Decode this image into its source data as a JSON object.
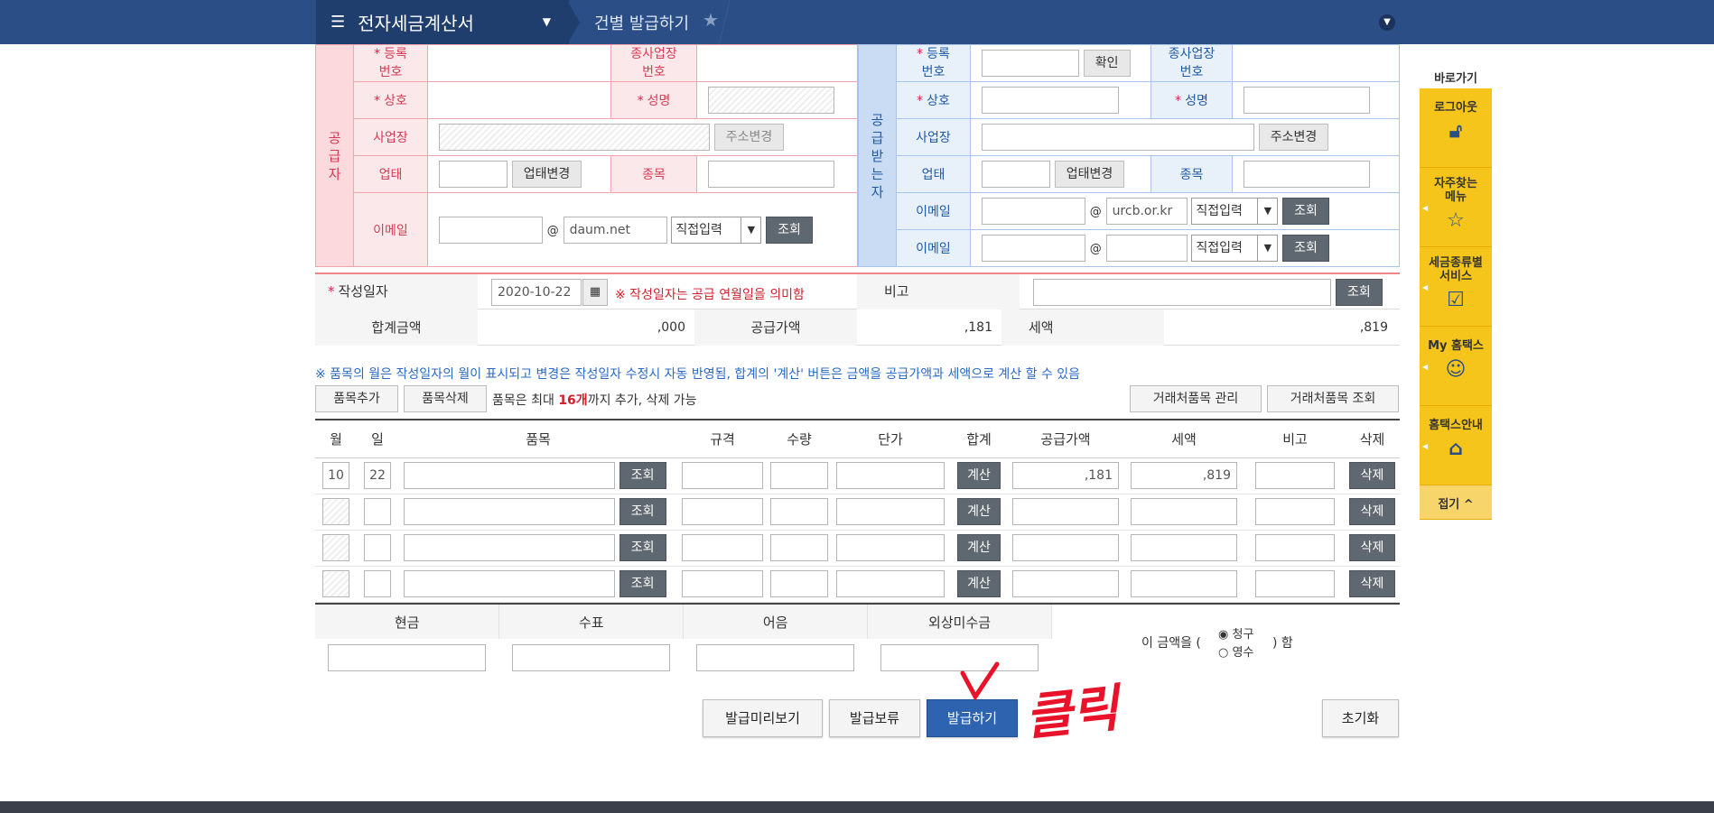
{
  "header": {
    "menu_title": "전자세금계산서",
    "breadcrumb": "건별 발급하기"
  },
  "supplier": {
    "side_label": "공급자",
    "reg_label": "등록\n번호",
    "sub_reg_label": "종사업장\n번호",
    "name_label": "상호",
    "ceo_label": "성명",
    "addr_label": "사업장",
    "addr_btn": "주소변경",
    "biz_label": "업태",
    "biz_btn": "업태변경",
    "item_label": "종목",
    "email_label": "이메일",
    "email_domain": "daum.net",
    "email_select": "직접입력",
    "lookup": "조회"
  },
  "receiver": {
    "side_label": "공급받는자",
    "reg_label": "등록\n번호",
    "confirm_btn": "확인",
    "sub_reg_label": "종사업장\n번호",
    "name_label": "상호",
    "ceo_label": "성명",
    "addr_label": "사업장",
    "addr_btn": "주소변경",
    "biz_label": "업태",
    "biz_btn": "업태변경",
    "item_label": "종목",
    "email_label": "이메일",
    "email_domain": "urcb.or.kr",
    "email_select": "직접입력",
    "lookup": "조회",
    "email2_label": "이메일",
    "email2_select": "직접입력",
    "lookup2": "조회"
  },
  "date": {
    "label": "작성일자",
    "value": "2020-10-22",
    "note": "※ 작성일자는 공급 연월일을 의미함",
    "remark_label": "비고",
    "remark_btn": "조회"
  },
  "totals": {
    "total_label": "합계금액",
    "total_value": ",000",
    "supply_label": "공급가액",
    "supply_value": ",181",
    "tax_label": "세액",
    "tax_value": ",819"
  },
  "notice": "※ 품목의 월은 작성일자의 월이 표시되고 변경은 작성일자 수정시 자동 반영됨, 합계의 '계산' 버튼은 금액을 공급가액과 세액으로 계산 할 수 있음",
  "item_ctrl": {
    "add": "품목추가",
    "del": "품목삭제",
    "msg_a": "품목은 최대 ",
    "msg_b": "16개",
    "msg_c": "까지 추가, 삭제 가능",
    "manage": "거래처품목 관리",
    "lookup": "거래처품목 조회"
  },
  "items_head": [
    "월",
    "일",
    "품목",
    "규격",
    "수량",
    "단가",
    "합계",
    "공급가액",
    "세액",
    "비고",
    "삭제"
  ],
  "items": [
    {
      "month": "10",
      "day": "22",
      "supply": ",181",
      "tax": ",819"
    },
    {
      "month": "",
      "day": "",
      "supply": "",
      "tax": ""
    },
    {
      "month": "",
      "day": "",
      "supply": "",
      "tax": ""
    },
    {
      "month": "",
      "day": "",
      "supply": "",
      "tax": ""
    }
  ],
  "row_btn": {
    "lookup": "조회",
    "calc": "계산",
    "delete": "삭제"
  },
  "payment": {
    "cash": "현금",
    "check": "수표",
    "note": "어음",
    "credit": "외상미수금",
    "prefix": "이 금액을 (",
    "opt1": "청구",
    "opt2": "영수",
    "suffix": ") 함"
  },
  "actions": {
    "preview": "발급미리보기",
    "hold": "발급보류",
    "issue": "발급하기",
    "reset": "초기화",
    "annotation": "클릭"
  },
  "quick": {
    "title": "바로가기",
    "items": [
      "로그아웃",
      "자주찾는\n메뉴",
      "세금종류별\n서비스",
      "My 홈택스",
      "홈택스안내"
    ],
    "fold": "접기 ^"
  }
}
